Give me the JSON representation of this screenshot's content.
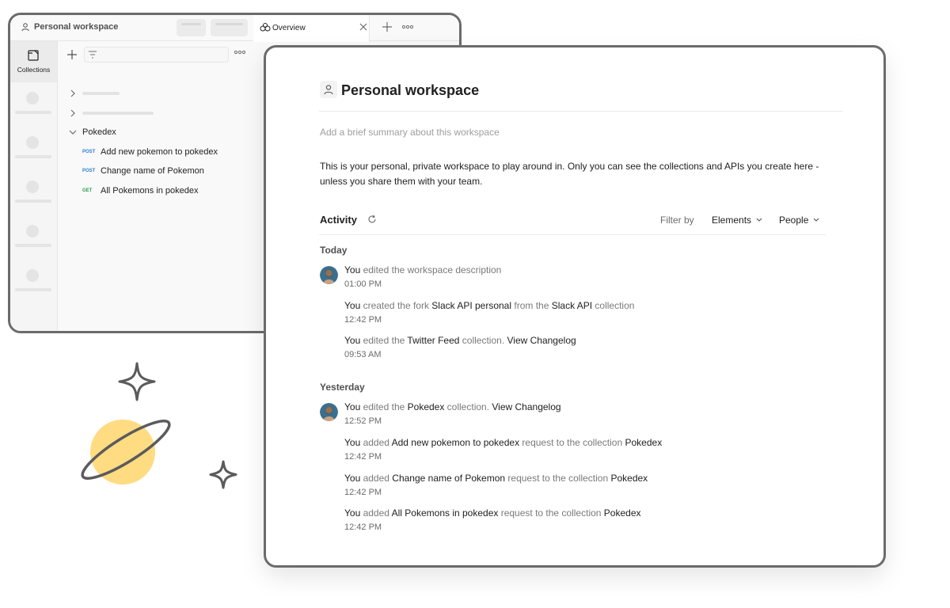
{
  "back_window": {
    "title": "Personal workspace",
    "tab": {
      "label": "Overview"
    },
    "rail": {
      "active_label": "Collections"
    },
    "sidebar": {
      "folder": "Pokedex",
      "requests": [
        {
          "method": "POST",
          "name": "Add new pokemon to pokedex"
        },
        {
          "method": "POST",
          "name": "Change name of Pokemon"
        },
        {
          "method": "GET",
          "name": "All Pokemons in pokedex"
        }
      ]
    }
  },
  "workspace": {
    "title": "Personal workspace",
    "summary_placeholder": "Add a brief summary about this workspace",
    "description": "This is your personal, private workspace to play around in. Only you can see the collections and APIs you create here - unless you share them with your team."
  },
  "activity": {
    "title": "Activity",
    "filter_label": "Filter by",
    "filter_elements": "Elements",
    "filter_people": "People",
    "groups": [
      {
        "day": "Today",
        "events": [
          {
            "parts": [
              [
                "You",
                true
              ],
              [
                " edited the workspace description",
                false
              ]
            ],
            "time": "01:00 PM"
          },
          {
            "parts": [
              [
                "You",
                true
              ],
              [
                " created the fork ",
                false
              ],
              [
                "Slack API personal",
                true
              ],
              [
                " from the ",
                false
              ],
              [
                "Slack API",
                true
              ],
              [
                " collection",
                false
              ]
            ],
            "time": "12:42 PM"
          },
          {
            "parts": [
              [
                "You",
                true
              ],
              [
                " edited the ",
                false
              ],
              [
                "Twitter Feed",
                true
              ],
              [
                " collection. ",
                false
              ],
              [
                "View Changelog",
                true
              ]
            ],
            "time": "09:53 AM"
          }
        ]
      },
      {
        "day": "Yesterday",
        "events": [
          {
            "parts": [
              [
                "You",
                true
              ],
              [
                " edited the ",
                false
              ],
              [
                "Pokedex",
                true
              ],
              [
                " collection. ",
                false
              ],
              [
                "View Changelog",
                true
              ]
            ],
            "time": "12:52 PM"
          },
          {
            "parts": [
              [
                "You",
                true
              ],
              [
                " added ",
                false
              ],
              [
                "Add new pokemon to pokedex",
                true
              ],
              [
                " request to the collection ",
                false
              ],
              [
                "Pokedex",
                true
              ]
            ],
            "time": "12:42 PM"
          },
          {
            "parts": [
              [
                "You",
                true
              ],
              [
                " added ",
                false
              ],
              [
                "Change name of Pokemon",
                true
              ],
              [
                " request to the collection ",
                false
              ],
              [
                "Pokedex",
                true
              ]
            ],
            "time": "12:42 PM"
          },
          {
            "parts": [
              [
                "You",
                true
              ],
              [
                " added ",
                false
              ],
              [
                "All Pokemons in pokedex",
                true
              ],
              [
                " request to the collection ",
                false
              ],
              [
                "Pokedex",
                true
              ]
            ],
            "time": "12:42 PM"
          }
        ]
      }
    ]
  },
  "colors": {
    "frame": "#6b6b6b",
    "post_method": "#2f7ed8",
    "get_method": "#2e9c51",
    "planet": "#ffdc82"
  }
}
